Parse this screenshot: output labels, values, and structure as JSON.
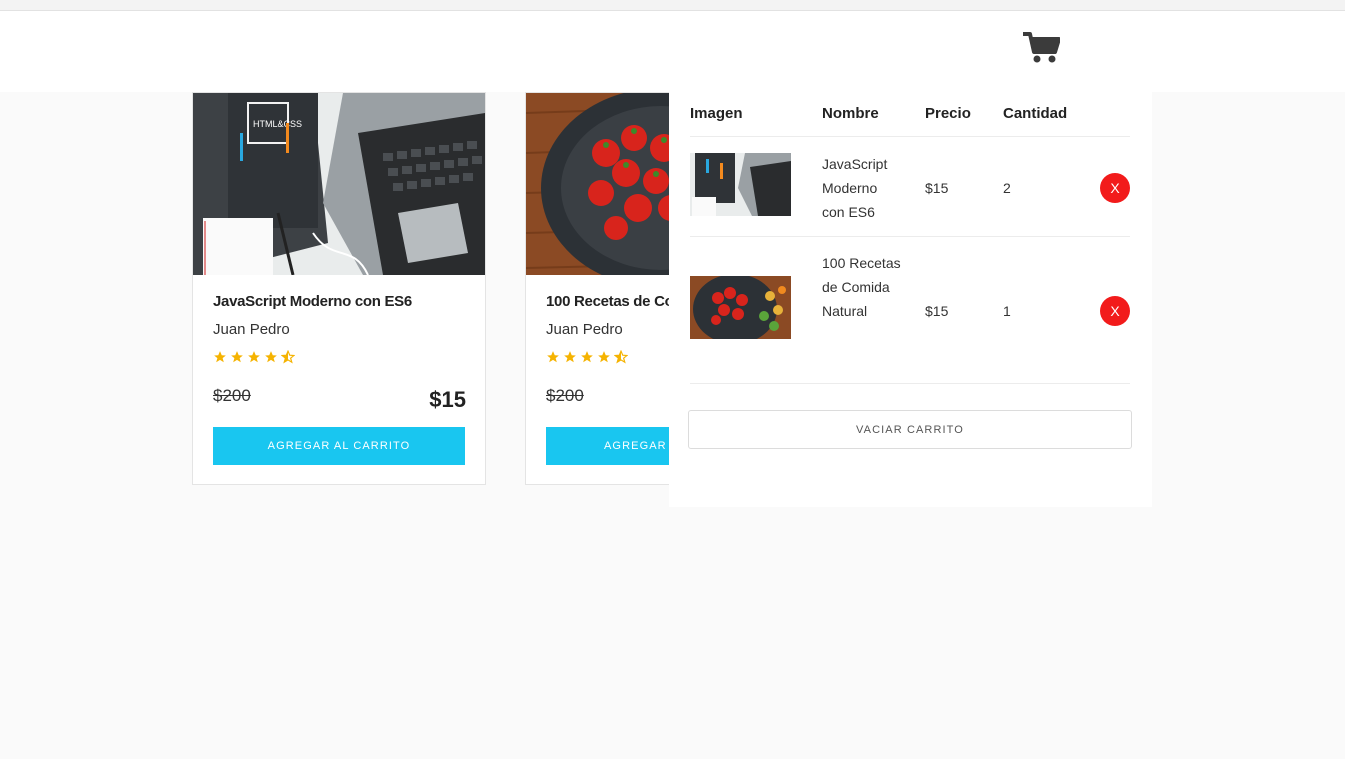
{
  "header": {
    "cart_icon": "shopping-cart-icon"
  },
  "courses": [
    {
      "title": "JavaScript Moderno con ES6",
      "author": "Juan Pedro",
      "rating": 4.5,
      "price_old": "$200",
      "price_new": "$15",
      "button": "Agregar al Carrito"
    },
    {
      "title": "100 Recetas de Co",
      "author": "Juan Pedro",
      "rating": 4.5,
      "price_old": "$200",
      "button": "Agregar A"
    }
  ],
  "cart": {
    "headers": {
      "image": "Imagen",
      "name": "Nombre",
      "price": "Precio",
      "qty": "Cantidad"
    },
    "rows": [
      {
        "name": "JavaScript Moderno con ES6",
        "price": "$15",
        "qty": "2",
        "remove": "X"
      },
      {
        "name": "100 Recetas de Comida Natural",
        "price": "$15",
        "qty": "1",
        "remove": "X"
      }
    ],
    "empty_button": "VACIAR CARRITO"
  },
  "colors": {
    "accent": "#19c6f0",
    "remove": "#f21b1b",
    "star": "#f5b301"
  }
}
